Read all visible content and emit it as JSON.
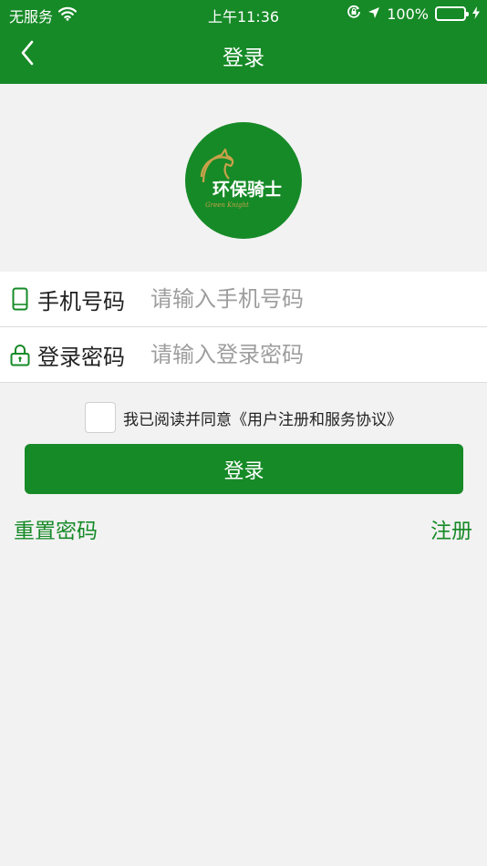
{
  "status_bar": {
    "carrier": "无服务",
    "time": "上午11:36",
    "battery": "100%"
  },
  "nav": {
    "title": "登录"
  },
  "logo": {
    "text": "环保骑士",
    "subtext": "Green Knight"
  },
  "form": {
    "phone_label": "手机号码",
    "phone_placeholder": "请输入手机号码",
    "password_label": "登录密码",
    "password_placeholder": "请输入登录密码"
  },
  "agreement": {
    "text": "我已阅读并同意《用户注册和服务协议》",
    "checked": false
  },
  "login_button": "登录",
  "links": {
    "reset": "重置密码",
    "register": "注册"
  },
  "colors": {
    "brand": "#168a27",
    "background": "#f2f2f2"
  }
}
